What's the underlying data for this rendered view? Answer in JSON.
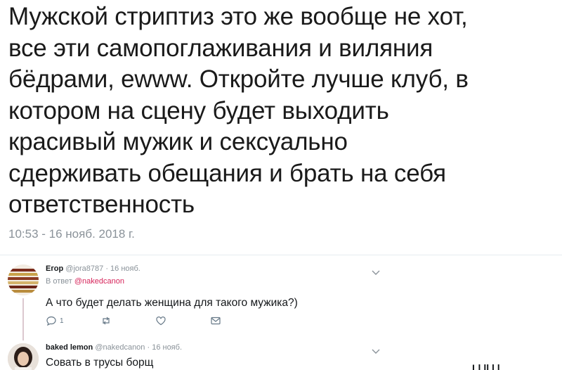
{
  "main_tweet": {
    "lines": [
      "Мужской стриптиз это же вообще не хот,",
      "все эти самопоглаживания и виляния",
      "бёдрами, ewww. Откройте лучше клуб, в",
      "котором на сцену будет выходить",
      "красивый мужик и сексуально",
      "сдерживать обещания и брать на себя",
      "ответственность"
    ],
    "timestamp": "10:53 - 16 нояб. 2018 г."
  },
  "replies": [
    {
      "name": "Егор",
      "handle": "@jora8787",
      "separator": " · ",
      "date": "16 нояб.",
      "reply_to_prefix": "В ответ ",
      "reply_to_mention": "@nakedcanon",
      "text": "А что будет делать  женщина для такого мужика?)",
      "reply_count": "1",
      "avatar_icon": "bookshelf-avatar"
    },
    {
      "name": "baked lemon",
      "handle": "@nakedcanon",
      "separator": " · ",
      "date": "16 нояб.",
      "text": "Совать в трусы борщ",
      "avatar_icon": "person-avatar"
    }
  ],
  "bottom_fragment": "Ll ll l l",
  "colors": {
    "text": "#14171a",
    "meta": "#8a9299",
    "mention": "#d6245a",
    "divider": "#e6ecf0",
    "thread_line": "#dcc8cf"
  }
}
